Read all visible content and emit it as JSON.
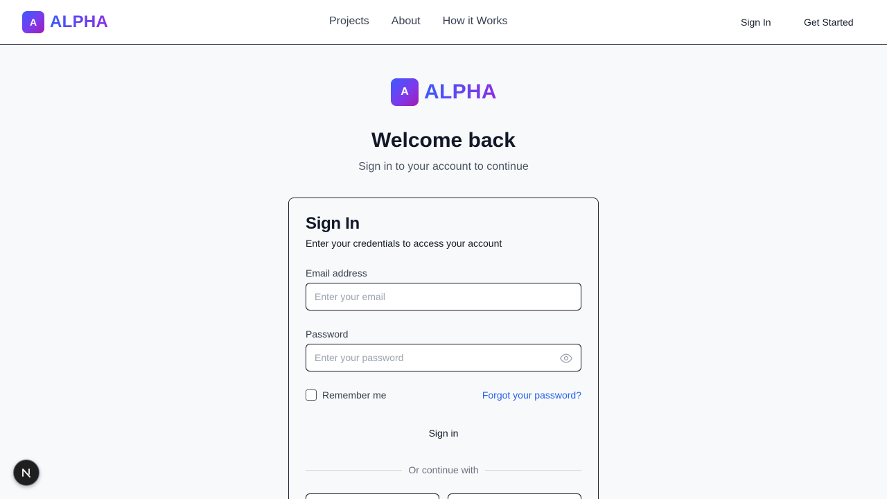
{
  "header": {
    "logo_letter": "A",
    "brand": "ALPHA",
    "nav": [
      "Projects",
      "About",
      "How it Works"
    ],
    "sign_in": "Sign In",
    "get_started": "Get Started"
  },
  "hero": {
    "logo_letter": "A",
    "brand": "ALPHA",
    "title": "Welcome back",
    "subtitle": "Sign in to your account to continue"
  },
  "card": {
    "title": "Sign In",
    "description": "Enter your credentials to access your account",
    "email_label": "Email address",
    "email_placeholder": "Enter your email",
    "password_label": "Password",
    "password_placeholder": "Enter your password",
    "remember_label": "Remember me",
    "forgot_link": "Forgot your password?",
    "submit_label": "Sign in",
    "divider_text": "Or continue with"
  },
  "colors": {
    "accent_start": "#3b5bfd",
    "accent_end": "#8b2fe6",
    "link": "#2563eb"
  },
  "icons": {
    "password_toggle": "eye-icon",
    "dev_badge": "nextjs-icon"
  }
}
